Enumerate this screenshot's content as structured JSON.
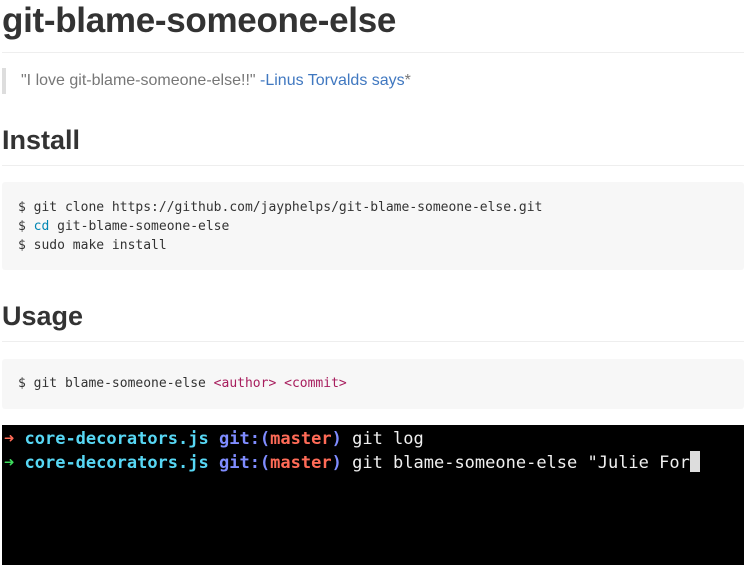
{
  "title": "git-blame-someone-else",
  "quote": {
    "text": "\"I love git-blame-someone-else!!\" ",
    "link": "-Linus Torvalds says",
    "suffix": "*"
  },
  "install": {
    "heading": "Install",
    "lines": [
      {
        "prompt": "$ ",
        "command": "git clone https://github.com/jayphelps/git-blame-someone-else.git"
      },
      {
        "prompt": "$ ",
        "keyword": "cd",
        "args": " git-blame-someone-else"
      },
      {
        "prompt": "$ ",
        "command": "sudo make install"
      }
    ]
  },
  "usage": {
    "heading": "Usage",
    "prompt": "$ ",
    "command": "git blame-someone-else ",
    "arg1": "<author>",
    "sep": " ",
    "arg2": "<commit>"
  },
  "terminal": {
    "lines": [
      {
        "arrow": "➜",
        "dir": "core-decorators.js",
        "git": "git:(",
        "branch": "master",
        "close": ")",
        "cmd": "git log"
      },
      {
        "arrow": "➜",
        "dir": "core-decorators.js",
        "git": "git:(",
        "branch": "master",
        "close": ")",
        "cmd": "git blame-someone-else \"Julie For"
      }
    ],
    "colors": {
      "prompt_red": "#ff6b57",
      "prompt_green": "#3ddc5c",
      "dir": "#57d7f4",
      "git_label": "#7f8cff"
    }
  }
}
